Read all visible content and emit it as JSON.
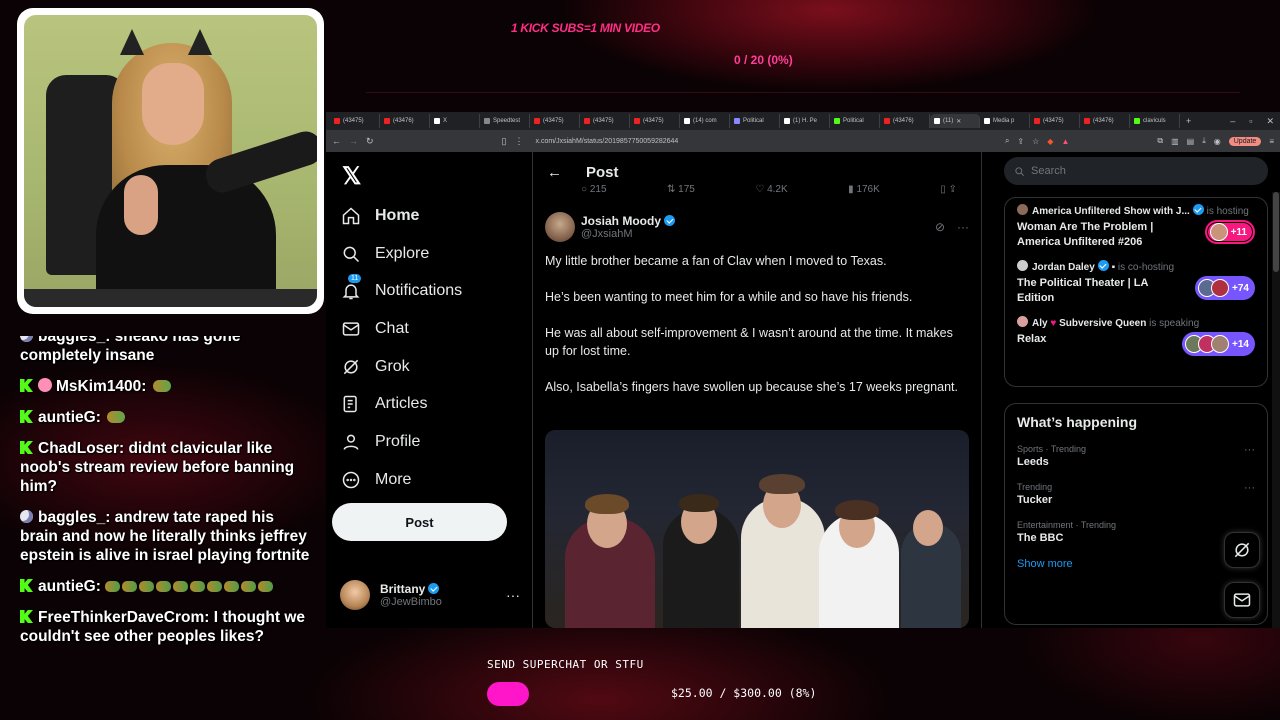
{
  "overlay": {
    "goal_title": "1 KICK SUBS=1 MIN VIDEO",
    "goal_progress": "0 / 20 (0%)",
    "superchat_label": "SEND SUPERCHAT OR STFU",
    "superchat_amount": "$25.00 / $300.00 (8%)",
    "superchat_fraction": 0.08
  },
  "chat": {
    "messages": [
      {
        "badge": "moon",
        "user": "baggles_",
        "text": "sneako has gone completely insane"
      },
      {
        "badge": "kick",
        "user": "MsKim1400",
        "text": ""
      },
      {
        "badge": "kick",
        "user": "auntieG",
        "text": ""
      },
      {
        "badge": "kick",
        "user": "ChadLoser",
        "text": "didnt clavicular like noob's stream review before banning him?"
      },
      {
        "badge": "moon",
        "user": "baggles_",
        "text": "andrew tate raped his brain and now he literally thinks jeffrey epstein is alive in israel playing fortnite"
      },
      {
        "badge": "kick",
        "user": "auntieG",
        "text": ""
      },
      {
        "badge": "kick",
        "user": "FreeThinkerDaveCrom",
        "text": "I thought we couldn't see other peoples likes?"
      }
    ]
  },
  "browser": {
    "tabs": [
      "(43475)",
      "(43476)",
      "X",
      "Speedtest",
      "(43475)",
      "(43475)",
      "(43475)",
      "(14) com",
      "Political",
      "(1) H. Pe",
      "Political",
      "(43476)",
      "(11)",
      "Media p",
      "(43475)",
      "(43476)",
      "claviculs"
    ],
    "url": "x.com/JxsiahM/status/2019857750059282644",
    "update_label": "Update"
  },
  "x": {
    "logo": "𝕏",
    "nav": [
      {
        "label": "Home",
        "icon": "home-icon"
      },
      {
        "label": "Explore",
        "icon": "search-icon"
      },
      {
        "label": "Notifications",
        "icon": "bell-icon",
        "badge": "11"
      },
      {
        "label": "Chat",
        "icon": "mail-icon"
      },
      {
        "label": "Grok",
        "icon": "grok-icon"
      },
      {
        "label": "Articles",
        "icon": "article-icon"
      },
      {
        "label": "Profile",
        "icon": "person-icon"
      },
      {
        "label": "More",
        "icon": "more-circle-icon"
      }
    ],
    "post_button": "Post",
    "account": {
      "name": "Brittany",
      "handle": "@JewBimbo"
    },
    "main_title": "Post",
    "action_counts": {
      "replies": "215",
      "reposts": "175",
      "likes": "4.2K",
      "views": "176K"
    },
    "post": {
      "author": "Josiah Moody",
      "handle": "@JxsiahM",
      "paragraphs": [
        "My little brother became a fan of Clav when I moved to Texas.",
        "He’s been wanting to meet him for a while and so have his friends.",
        "He was all about self-improvement & I wasn’t around at the time. It makes up for lost time.",
        "Also, Isabella’s fingers have swollen up because she’s 17 weeks pregnant."
      ]
    },
    "search_placeholder": "Search",
    "spaces": [
      {
        "host": "America Unfiltered Show with J...",
        "state": "is hosting",
        "title": "Woman Are The Problem | America Unfiltered #206",
        "count": "+11",
        "color": "#f91880"
      },
      {
        "host": "Jordan Daley",
        "state": "is co-hosting",
        "title": "The Political Theater | LA Edition",
        "count": "+74",
        "color": "#7856ff"
      },
      {
        "host": "Aly",
        "host2": "Subversive Queen",
        "state": "is speaking",
        "title": "Relax",
        "count": "+14",
        "color": "#7856ff"
      }
    ],
    "happening": {
      "title": "What’s happening",
      "trends": [
        {
          "meta": "Sports · Trending",
          "name": "Leeds"
        },
        {
          "meta": "Trending",
          "name": "Tucker"
        },
        {
          "meta": "Entertainment · Trending",
          "name": "The BBC"
        }
      ],
      "show_more": "Show more"
    }
  }
}
